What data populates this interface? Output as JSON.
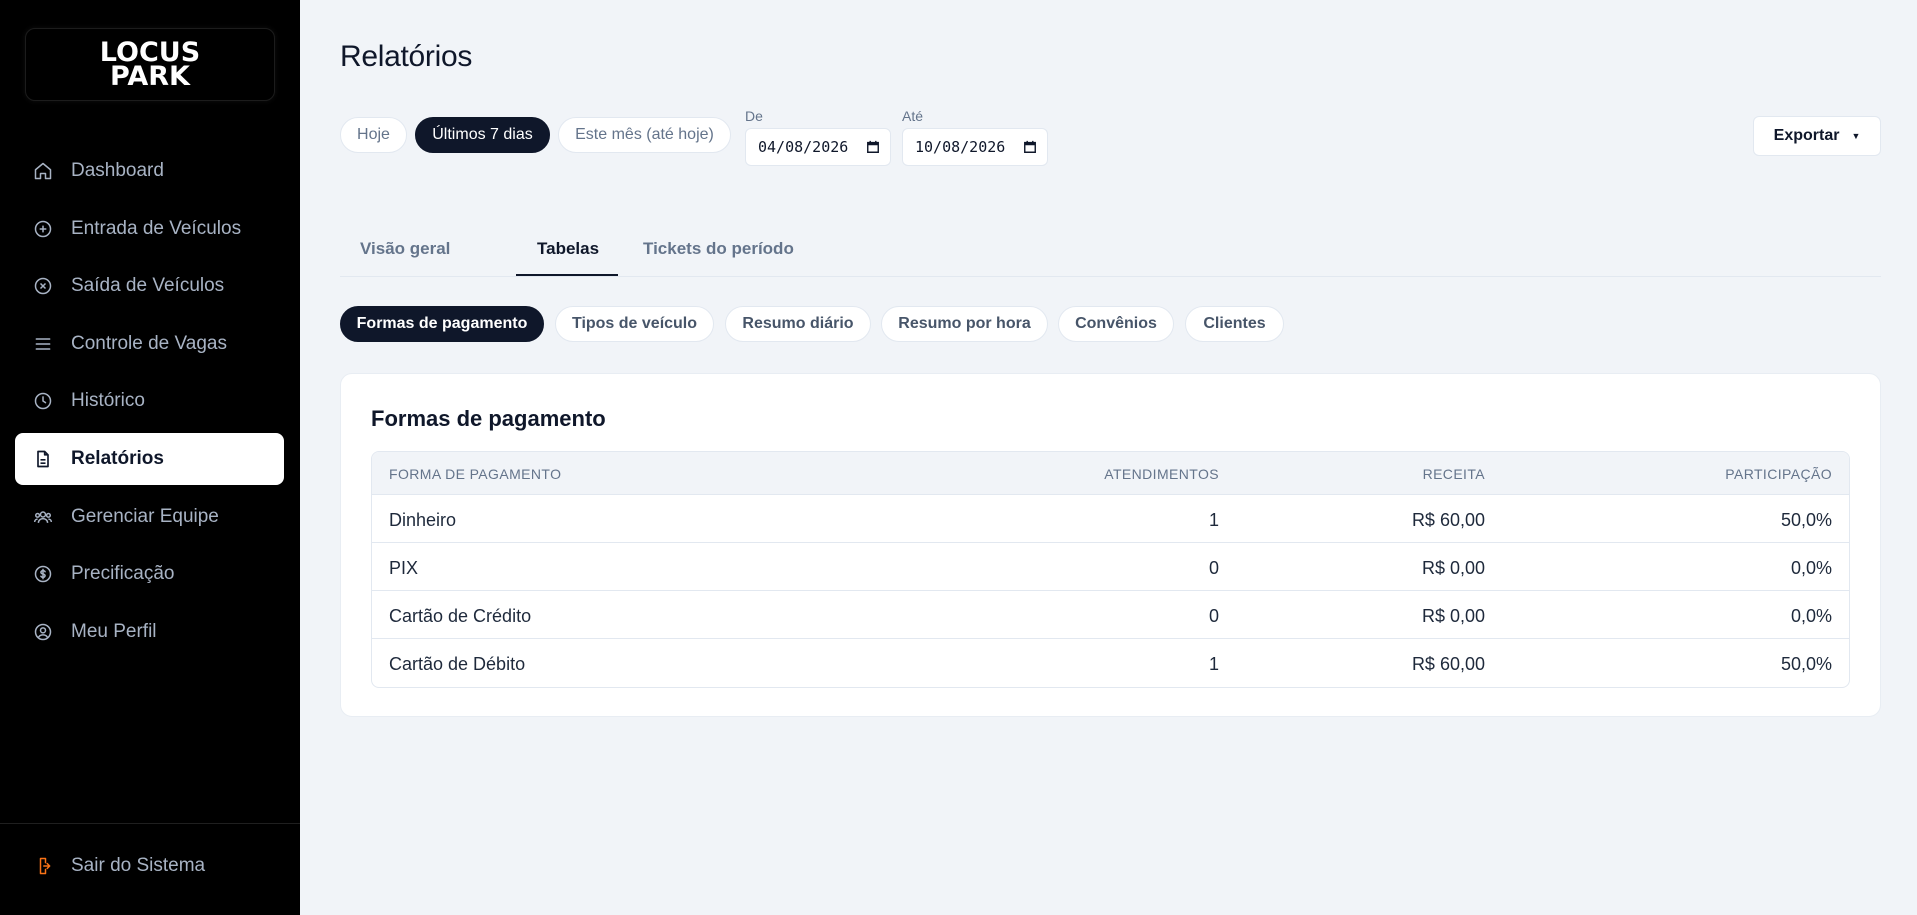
{
  "brand": {
    "line1": "LOCUS",
    "line2": "PARK"
  },
  "sidebar": {
    "items": [
      {
        "label": "Dashboard",
        "icon": "home-icon"
      },
      {
        "label": "Entrada de Veículos",
        "icon": "plus-circle-icon"
      },
      {
        "label": "Saída de Veículos",
        "icon": "x-circle-icon"
      },
      {
        "label": "Controle de Vagas",
        "icon": "menu-icon"
      },
      {
        "label": "Histórico",
        "icon": "clock-icon"
      },
      {
        "label": "Relatórios",
        "icon": "file-text-icon",
        "active": true
      },
      {
        "label": "Gerenciar Equipe",
        "icon": "users-icon"
      },
      {
        "label": "Precificação",
        "icon": "dollar-circle-icon"
      },
      {
        "label": "Meu Perfil",
        "icon": "user-circle-icon"
      }
    ],
    "logout": {
      "label": "Sair do Sistema",
      "icon": "logout-icon"
    }
  },
  "header": {
    "title": "Relatórios"
  },
  "filters": {
    "presets": [
      "Hoje",
      "Últimos 7 dias",
      "Este mês (até hoje)"
    ],
    "active_preset": "Últimos 7 dias",
    "from": {
      "label": "De",
      "value": "04/08/2026"
    },
    "to": {
      "label": "Até",
      "value": "10/08/2026"
    }
  },
  "export": {
    "label": "Exportar"
  },
  "tabs": [
    "Visão geral",
    "Tabelas",
    "Tickets do período"
  ],
  "active_tab": "Tabelas",
  "subtabs": [
    "Formas de pagamento",
    "Tipos de veículo",
    "Resumo diário",
    "Resumo por hora",
    "Convênios",
    "Clientes"
  ],
  "active_subtab": "Formas de pagamento",
  "table": {
    "title": "Formas de pagamento",
    "columns": [
      "FORMA DE PAGAMENTO",
      "ATENDIMENTOS",
      "RECEITA",
      "PARTICIPAÇÃO"
    ],
    "rows": [
      [
        "Dinheiro",
        "1",
        "R$ 60,00",
        "50,0%"
      ],
      [
        "PIX",
        "0",
        "R$ 0,00",
        "0,0%"
      ],
      [
        "Cartão de Crédito",
        "0",
        "R$ 0,00",
        "0,0%"
      ],
      [
        "Cartão de Débito",
        "1",
        "R$ 60,00",
        "50,0%"
      ]
    ]
  },
  "colors": {
    "sidebar_bg": "#000000",
    "accent_dark": "#0f172a",
    "page_bg": "#f1f4f8",
    "logout_icon": "#f97316"
  }
}
